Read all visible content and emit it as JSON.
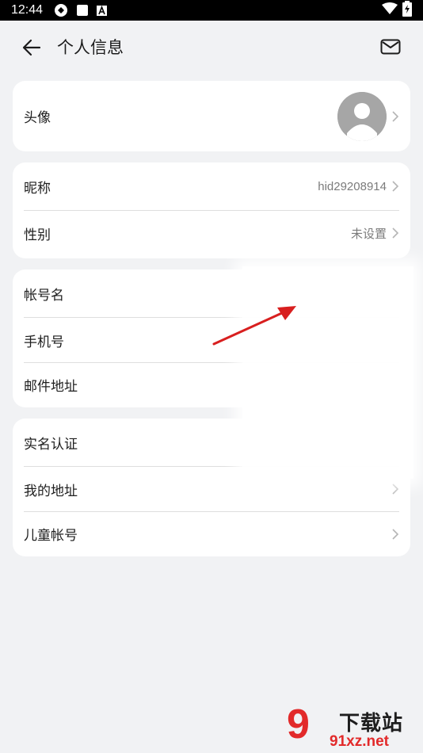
{
  "status_bar": {
    "time": "12:44",
    "icons": [
      "sync-icon",
      "square-icon",
      "a-badge-icon",
      "wifi-icon",
      "battery-charging-icon"
    ]
  },
  "header": {
    "title": "个人信息",
    "back_icon": "back-arrow-icon",
    "mail_icon": "mail-icon"
  },
  "sections": {
    "avatar": {
      "label": "头像"
    },
    "nickname": {
      "label": "昵称",
      "value": "hid29208914"
    },
    "gender": {
      "label": "性别",
      "value": "未设置"
    },
    "account_name": {
      "label": "帐号名"
    },
    "phone": {
      "label": "手机号"
    },
    "email": {
      "label": "邮件地址"
    },
    "real_name": {
      "label": "实名认证"
    },
    "my_address": {
      "label": "我的地址"
    },
    "child_account": {
      "label": "儿童帐号"
    }
  },
  "annotation": {
    "color": "#d81f1f"
  },
  "watermark": {
    "number": "9",
    "title": "下载站",
    "url": "91xz.net",
    "accent": "#e22a2a"
  },
  "colors": {
    "background": "#f1f2f4",
    "card": "#ffffff",
    "divider": "#dedede",
    "secondary_text": "#7b7b7b"
  }
}
